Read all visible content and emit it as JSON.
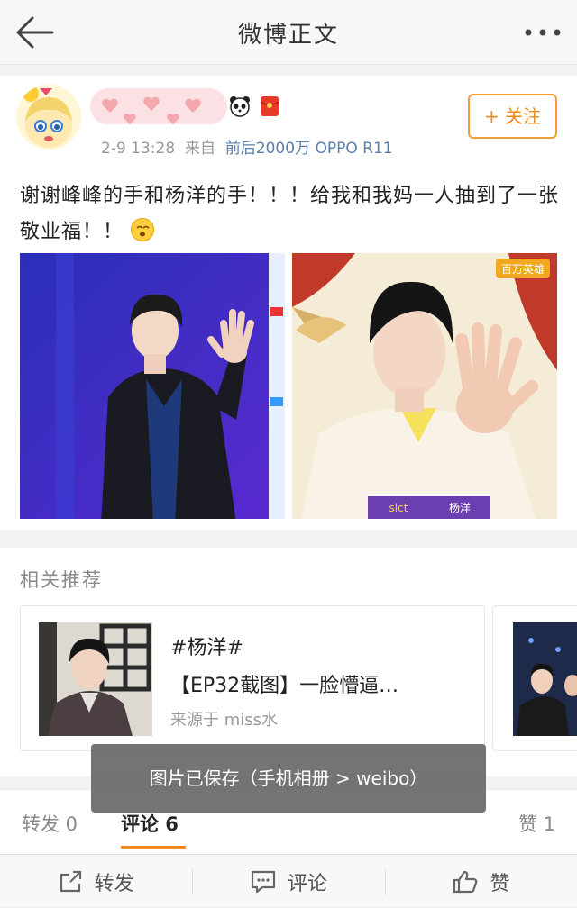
{
  "nav": {
    "title": "微博正文",
    "back_icon": "back-arrow-icon",
    "more_icon": "more-dots-icon"
  },
  "post": {
    "time": "2-9 13:28",
    "from_label": "来自",
    "source": "前后2000万 OPPO R11",
    "follow_label": "+ 关注",
    "text": "谢谢峰峰的手和杨洋的手！！！给我和我妈一人抽到了一张敬业福！！",
    "images": [
      "photo-1",
      "photo-2"
    ],
    "image2_watermark": "百万英雄",
    "image2_caption_left": "slct",
    "image2_caption_right": "杨洋"
  },
  "related": {
    "title": "相关推荐",
    "card": {
      "tag": "#杨洋#",
      "text": "【EP32截图】一脸懵逼…",
      "source": "来源于 miss水"
    }
  },
  "toast": {
    "text": "图片已保存（手机相册 > weibo）"
  },
  "stats": {
    "repost": "转发 0",
    "comment": "评论 6",
    "like": "赞 1"
  },
  "toolbar": {
    "repost": "转发",
    "comment": "评论",
    "like": "赞"
  },
  "colors": {
    "accent": "#f08a1c",
    "link": "#5b7ea8"
  }
}
